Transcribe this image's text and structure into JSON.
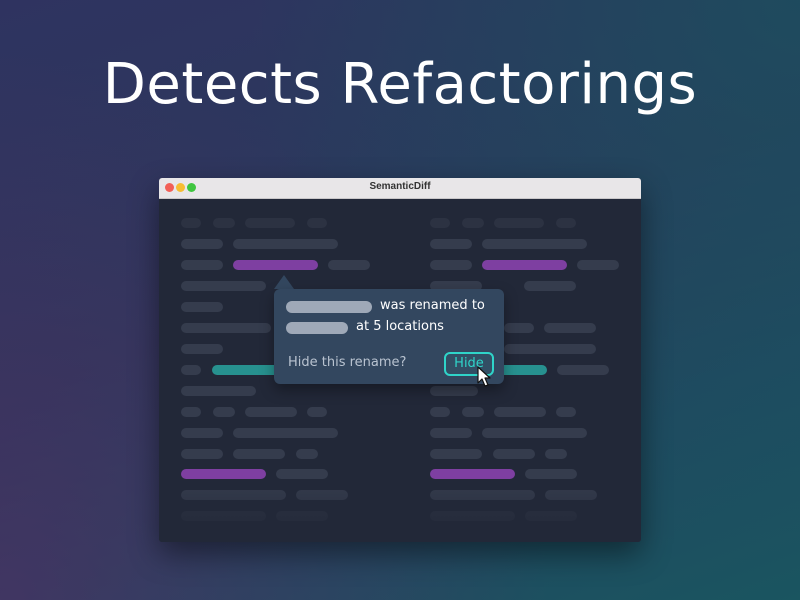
{
  "headline": "Detects Refactorings",
  "window": {
    "title": "SemanticDiff"
  },
  "popover": {
    "line1_suffix": "was renamed to",
    "line2_suffix": "at 5 locations",
    "question": "Hide this rename?",
    "hide_button_label": "Hide"
  },
  "colors": {
    "rename_highlight": "#7e3fa1",
    "moved_highlight": "#27918f",
    "accent": "#2fd4c9"
  },
  "icons": {
    "cursor": "mouse-pointer-icon"
  }
}
